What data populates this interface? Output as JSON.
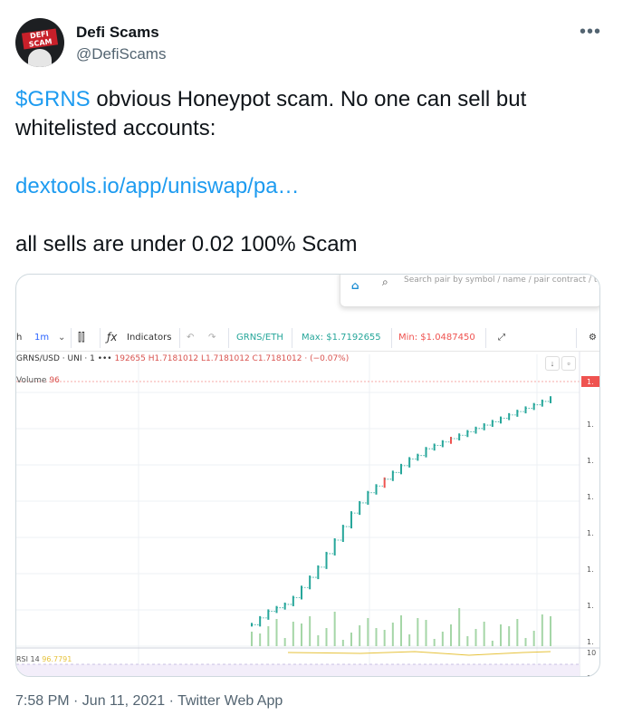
{
  "tweet": {
    "display_name": "Defi Scams",
    "handle": "@DefiScams",
    "avatar_text": "DEFI SCAM",
    "more_icon": "more-horizontal-icon",
    "ticker": "$GRNS",
    "text_part1": " obvious Honeypot scam. No one can sell but whitelisted accounts:",
    "link": "dextools.io/app/uniswap/pa…",
    "text_part2": "all sells are under 0.02 100% Scam",
    "footer": "7:58 PM · Jun 11, 2021 · Twitter Web App",
    "link_color": "#1d9bf0"
  },
  "chart": {
    "search_placeholder": "Search pair by symbol / name / pair contract / token c",
    "toolbar": {
      "interval_h": "h",
      "interval_1m": "1m",
      "indicators": "Indicators",
      "pair": "GRNS/ETH",
      "max": "Max: $1.7192655",
      "min": "Min: $1.0487450"
    },
    "legend": {
      "symbol": "GRNS/USD · UNI · 1",
      "dots": "•••",
      "ohlc": "192655 H1.7181012 L1.7181012 C1.7181012 · (−0.07%)"
    },
    "volume_label": "Volume",
    "volume_value": "96",
    "rsi_label": "RSI 14",
    "rsi_value": "96.7791",
    "price_axis_tag": "1.",
    "price_axis_label": "1.",
    "rsi_axis_label": "10",
    "colors": {
      "up": "#26a69a",
      "down": "#ef5350",
      "volume": "#a5d6a7",
      "max_text": "#26a69a",
      "min_text": "#ef5350",
      "pair_text": "#26a69a"
    }
  },
  "chart_data": {
    "type": "line",
    "title": "",
    "series": [
      {
        "values": [
          1.05,
          1.07,
          1.09,
          1.1,
          1.11,
          1.13,
          1.16,
          1.19,
          1.22,
          1.26,
          1.3,
          1.34,
          1.38,
          1.41,
          1.44,
          1.46,
          1.48,
          1.5,
          1.52,
          1.54,
          1.55,
          1.57,
          1.58,
          1.59,
          1.6,
          1.61,
          1.62,
          1.63,
          1.64,
          1.65,
          1.66,
          1.67,
          1.68,
          1.69,
          1.7,
          1.71,
          1.72
        ]
      }
    ],
    "ylim": [
      1.0,
      1.75
    ],
    "grid": true
  }
}
